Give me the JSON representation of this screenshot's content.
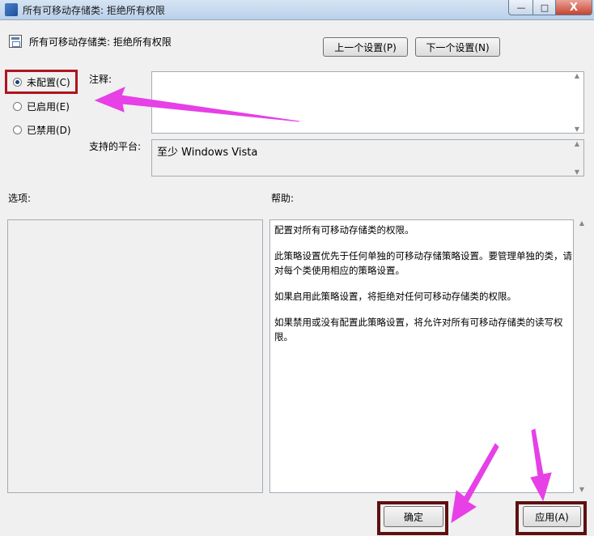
{
  "window": {
    "title": "所有可移动存储类: 拒绝所有权限",
    "minimize_glyph": "—",
    "maximize_glyph": "□",
    "close_glyph": "X"
  },
  "header": {
    "policy_name": "所有可移动存储类: 拒绝所有权限",
    "prev_button": "上一个设置(P)",
    "next_button": "下一个设置(N)"
  },
  "state": {
    "options": [
      {
        "label": "未配置(C)",
        "selected": true
      },
      {
        "label": "已启用(E)",
        "selected": false
      },
      {
        "label": "已禁用(D)",
        "selected": false
      }
    ]
  },
  "comment": {
    "label": "注释:",
    "value": ""
  },
  "platform": {
    "label": "支持的平台:",
    "value": "至少 Windows Vista"
  },
  "options_section": {
    "label": "选项:"
  },
  "help_section": {
    "label": "帮助:",
    "paragraphs": [
      "配置对所有可移动存储类的权限。",
      "此策略设置优先于任何单独的可移动存储策略设置。要管理单独的类，请对每个类使用相应的策略设置。",
      "如果启用此策略设置，将拒绝对任何可移动存储类的权限。",
      "如果禁用或没有配置此策略设置，将允许对所有可移动存储类的读写权限。"
    ]
  },
  "footer": {
    "ok_button": "确定",
    "apply_button": "应用(A)"
  },
  "colors": {
    "highlight_box": "#b0141e",
    "arrow": "#e640e6",
    "button_box": "#5e1010"
  }
}
